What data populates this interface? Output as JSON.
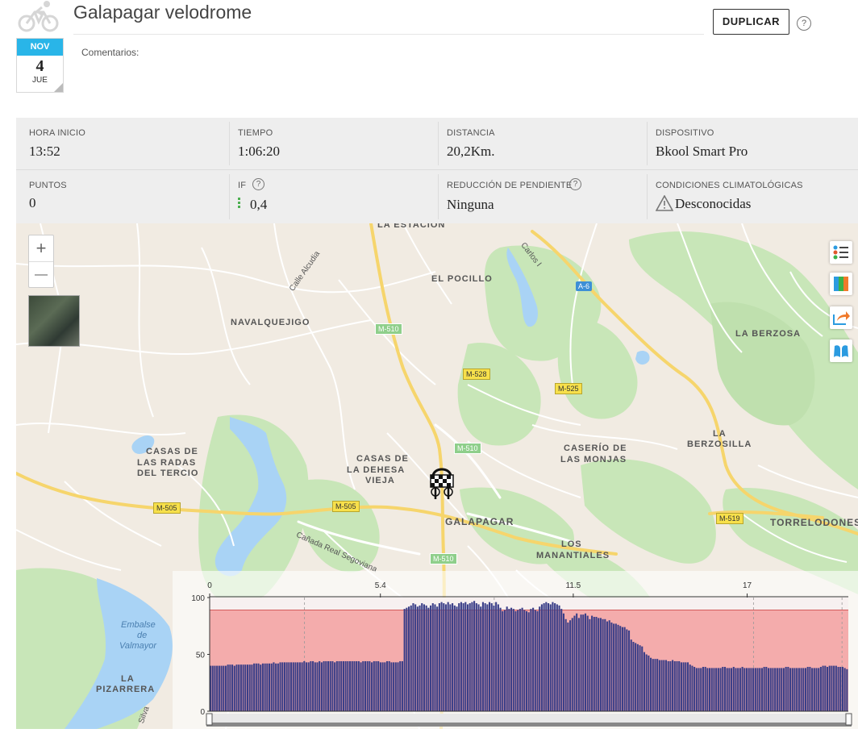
{
  "activity": {
    "title": "Galapagar velodrome",
    "comments_label": "Comentarios:",
    "duplicate_label": "DUPLICAR",
    "help_glyph": "?",
    "calendar": {
      "month": "NOV",
      "day": "4",
      "weekday": "JUE"
    }
  },
  "stats": [
    {
      "label": "HORA INICIO",
      "value": "13:52"
    },
    {
      "label": "TIEMPO",
      "value": "1:06:20"
    },
    {
      "label": "DISTANCIA",
      "value": "20,2Km."
    },
    {
      "label": "DISPOSITIVO",
      "value": "Bkool Smart Pro"
    },
    {
      "label": "PUNTOS",
      "value": "0"
    },
    {
      "label": "IF",
      "value": "0,4"
    },
    {
      "label": "REDUCCIÓN DE PENDIENTE",
      "value": "Ninguna"
    },
    {
      "label": "CONDICIONES CLIMATOLÓGICAS",
      "value": "Desconocidas"
    }
  ],
  "map": {
    "zoom_in": "+",
    "zoom_out": "—",
    "labels": {
      "la_estacion": "LA ESTACIÓN",
      "carlos": "Carlos I",
      "calle_alcudia": "Calle Alcudia",
      "el_pocillo": "EL POCILLO",
      "navalquejigo": "NAVALQUEJIGO",
      "la_berzosa": "LA BERZOSA",
      "la_berzosilla_1": "LA",
      "la_berzosilla_2": "BERZOSILLA",
      "casas_radas_1": "CASAS DE",
      "casas_radas_2": "LAS RADAS",
      "casas_radas_3": "DEL TERCIO",
      "casas_dehesa_1": "CASAS DE",
      "casas_dehesa_2": "LA DEHESA",
      "casas_dehesa_3": "VIEJA",
      "caserio_1": "CASERÍO DE",
      "caserio_2": "LAS MONJAS",
      "galapagar": "GALAPAGAR",
      "los_manantiales_1": "LOS",
      "los_manantiales_2": "MANANTIALES",
      "torrelodones": "TORRELODONES",
      "canada": "Cañada Real Segoviana",
      "embalse_1": "Embalse",
      "embalse_2": "de",
      "embalse_3": "Valmayor",
      "pizarrera_1": "LA",
      "pizarrera_2": "PIZARRERA",
      "silva": "Silva"
    },
    "roads": {
      "a6": "A-6",
      "m510a": "M-510",
      "m510b": "M-510",
      "m510c": "M-510",
      "m528": "M-528",
      "m525": "M-525",
      "m505a": "M-505",
      "m505b": "M-505",
      "m519": "M-519"
    }
  },
  "chart_data": {
    "type": "bar",
    "x_ticks": [
      "0",
      "5.4",
      "11.5",
      "17"
    ],
    "x_tick_values": [
      0,
      5.4,
      11.5,
      17
    ],
    "x_max": 20.2,
    "y_ticks": [
      "0",
      "50",
      "100"
    ],
    "ylim": [
      0,
      100
    ],
    "reference_level": 89,
    "bar_color": "#3b3f88",
    "band_color": "#f3a0a0",
    "values": [
      40,
      40,
      40,
      40,
      40,
      40,
      40,
      40,
      41,
      41,
      41,
      40,
      41,
      41,
      41,
      41,
      41,
      41,
      41,
      41,
      42,
      42,
      42,
      41,
      42,
      42,
      42,
      42,
      42,
      43,
      42,
      42,
      43,
      43,
      43,
      43,
      43,
      43,
      43,
      43,
      43,
      43,
      43,
      44,
      43,
      43,
      44,
      44,
      43,
      43,
      44,
      43,
      44,
      44,
      44,
      44,
      44,
      43,
      44,
      44,
      44,
      44,
      44,
      44,
      44,
      44,
      44,
      44,
      44,
      43,
      44,
      44,
      44,
      44,
      43,
      44,
      44,
      44,
      43,
      43,
      43,
      44,
      44,
      43,
      43,
      43,
      43,
      44,
      44,
      90,
      91,
      92,
      93,
      95,
      94,
      92,
      93,
      95,
      94,
      93,
      91,
      93,
      95,
      94,
      92,
      95,
      96,
      95,
      94,
      96,
      94,
      95,
      93,
      92,
      95,
      96,
      95,
      96,
      94,
      95,
      96,
      97,
      95,
      94,
      92,
      96,
      95,
      94,
      96,
      95,
      93,
      96,
      94,
      91,
      88,
      89,
      92,
      90,
      91,
      90,
      88,
      89,
      90,
      91,
      89,
      88,
      87,
      90,
      91,
      89,
      88,
      92,
      94,
      95,
      96,
      95,
      94,
      96,
      95,
      94,
      93,
      90,
      86,
      81,
      78,
      80,
      82,
      84,
      86,
      82,
      85,
      85,
      86,
      84,
      81,
      84,
      83,
      83,
      82,
      82,
      81,
      81,
      79,
      80,
      78,
      77,
      77,
      76,
      75,
      74,
      74,
      72,
      71,
      63,
      61,
      60,
      59,
      58,
      57,
      52,
      50,
      49,
      47,
      46,
      46,
      46,
      45,
      45,
      45,
      45,
      44,
      44,
      45,
      44,
      44,
      44,
      43,
      43,
      43,
      43,
      41,
      40,
      39,
      38,
      38,
      38,
      39,
      39,
      38,
      38,
      38,
      38,
      38,
      38,
      38,
      39,
      39,
      38,
      38,
      38,
      39,
      38,
      38,
      38,
      39,
      38,
      38,
      38,
      38,
      38,
      38,
      38,
      38,
      38,
      39,
      39,
      38,
      38,
      38,
      38,
      38,
      38,
      38,
      38,
      39,
      39,
      38,
      38,
      38,
      38,
      38,
      38,
      38,
      38,
      39,
      39,
      38,
      38,
      38,
      38,
      39,
      40,
      40,
      39,
      40,
      40,
      40,
      40,
      39,
      39,
      39,
      38,
      37
    ]
  }
}
